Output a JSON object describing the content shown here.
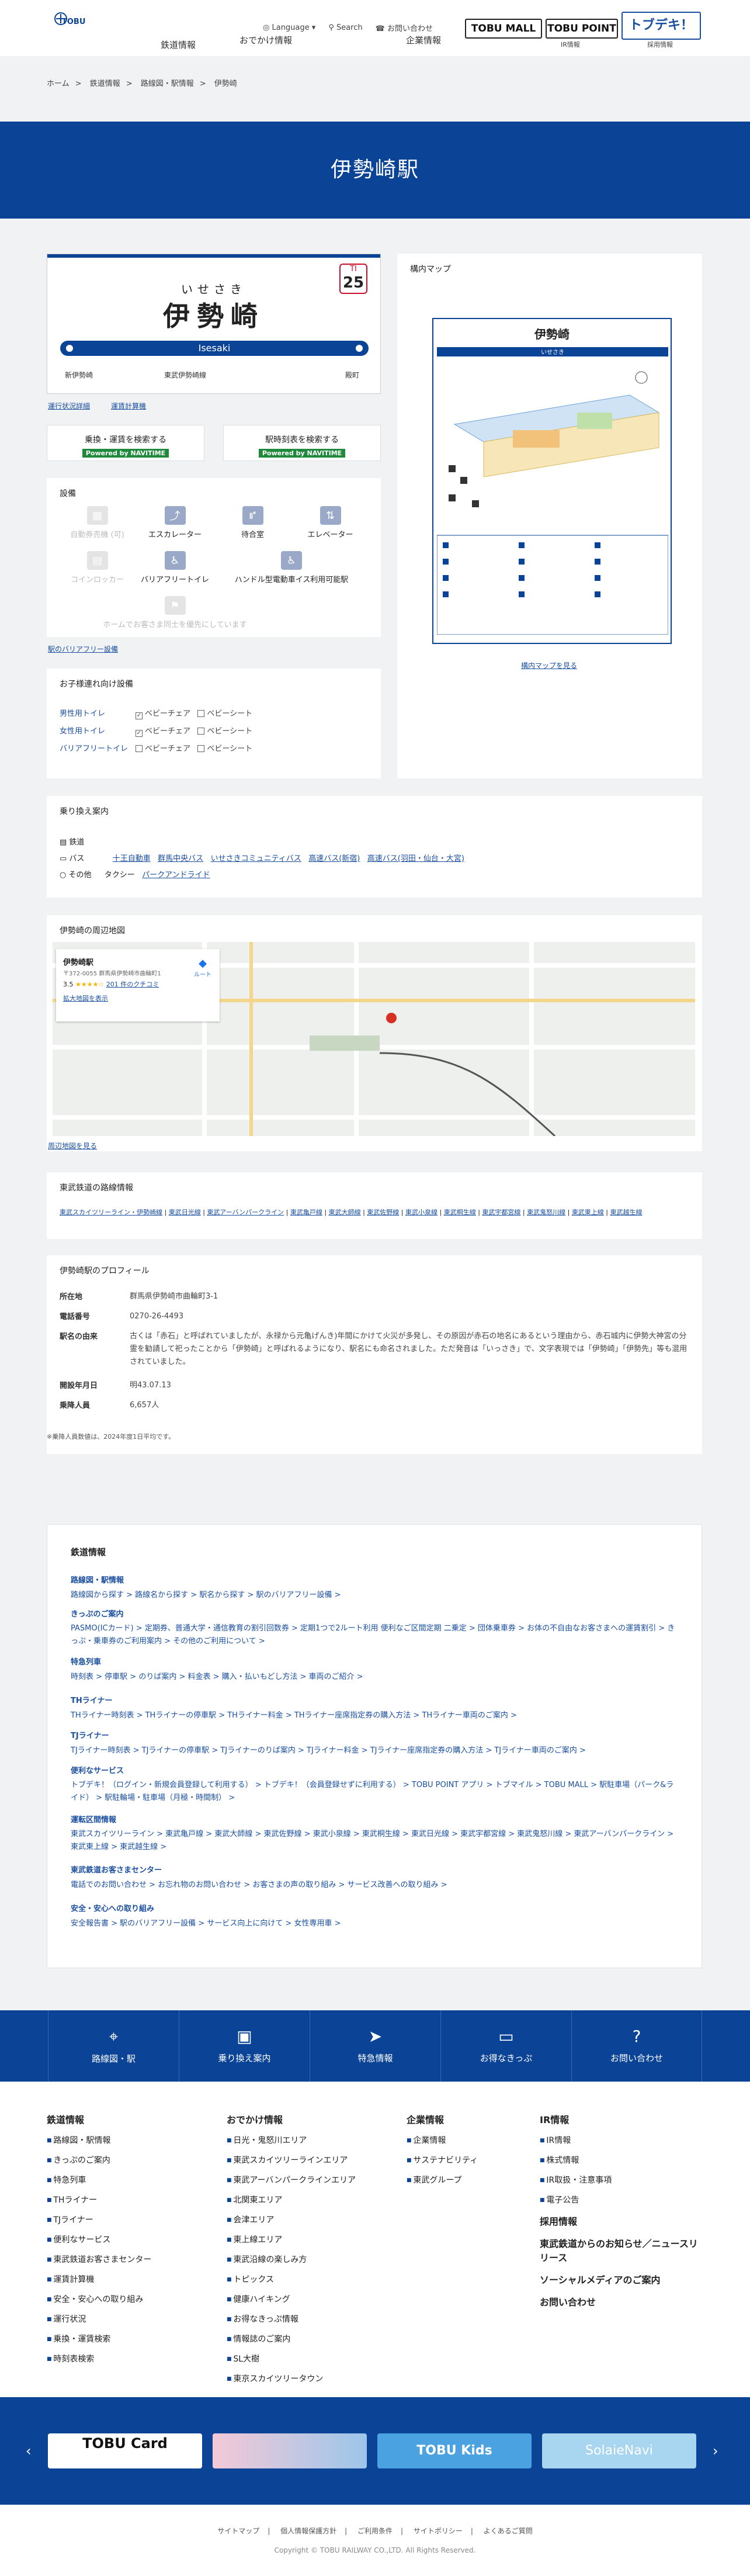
{
  "header": {
    "logo_text": "TOBU",
    "nav": [
      "鉄道情報",
      "おでかけ情報",
      "企業情報",
      "IR情報"
    ],
    "util": {
      "language": "Language",
      "search": "Search",
      "contact": "お問い合わせ"
    },
    "buttons": {
      "mall": "TOBU MALL",
      "point": "TOBU POINT",
      "tobudeki": "トブデキ！"
    },
    "button_sub": {
      "ir": "IR情報",
      "recruit": "採用情報"
    }
  },
  "breadcrumb": [
    "ホーム",
    "鉄道情報",
    "路線図・駅情報",
    "伊勢崎"
  ],
  "hero_title": "伊勢崎駅",
  "sign": {
    "kana": "いせさき",
    "kanji": "伊勢崎",
    "romaji": "Isesaki",
    "number_line": "TI",
    "number": "25",
    "prev": "新伊勢崎",
    "prev2": "東武伊勢崎線",
    "next": "殿町"
  },
  "links": {
    "timetable": "運行状況詳細",
    "nearby": "運賃計算機 "
  },
  "search_buttons": [
    {
      "label": "乗換・運賃を検索する",
      "powered": "Powered by NAVITIME"
    },
    {
      "label": "駅時刻表を検索する",
      "powered": "Powered by NAVITIME"
    }
  ],
  "facilities": {
    "title": "設備",
    "items": [
      {
        "label": "自動券売機 (可)",
        "on": false
      },
      {
        "label": "エスカレーター",
        "on": true
      },
      {
        "label": "待合室",
        "on": true
      },
      {
        "label": "エレベーター",
        "on": true
      },
      {
        "label": "コインロッカー",
        "on": false
      },
      {
        "label": "バリアフリートイレ",
        "on": true
      },
      {
        "label": "ハンドル型電動車イス利用可能駅",
        "on": true
      },
      {
        "label": "ホームでお客さま同士を優先にしています",
        "on": false
      }
    ],
    "link": "駅のバリアフリー設備 "
  },
  "station_map": {
    "title": "構内マップ",
    "station": "伊勢崎",
    "kana": "いせさき",
    "link": "構内マップを見る"
  },
  "care": {
    "title": "お子様連れ向け設備",
    "rows": [
      {
        "name": "男性用トイレ",
        "a": "ベビーチェア",
        "b": "ベビーシート"
      },
      {
        "name": "女性用トイレ",
        "a": "ベビーチェア",
        "b": "ベビーシート"
      },
      {
        "name": "バリアフリートイレ",
        "a": "ベビーチェア",
        "b": "ベビーシート"
      }
    ]
  },
  "transfer": {
    "title": "乗り換え案内",
    "rail": "鉄道",
    "bus_label": "バス",
    "bus": [
      "十王自動車",
      "群馬中央バス",
      "いせさきコミュニティバス",
      "高速バス(新宿)",
      "高速バス(羽田・仙台・大宮)"
    ],
    "other_label": "その他",
    "taxi": "タクシー",
    "parking": "パークアンドライド"
  },
  "nearby_map": {
    "title": "伊勢崎の周辺地図",
    "place": "伊勢崎駅",
    "address": "〒372-0055 群馬県伊勢崎市曲輪町1",
    "rating": "3.5",
    "reviews": "201 件のクチコミ",
    "enlarge": "拡大地図を表示",
    "route": "ルート",
    "link": "周辺地図を見る"
  },
  "lines": {
    "title": "東武鉄道の路線情報",
    "items": [
      "東武スカイツリーライン・伊勢崎線",
      "東武日光線",
      "東武アーバンパークライン",
      "東武亀戸線",
      "東武大師線",
      "東武佐野線",
      "東武小泉線",
      "東武桐生線",
      "東武宇都宮線",
      "東武鬼怒川線",
      "東武東上線",
      "東武越生線"
    ]
  },
  "profile": {
    "title": "伊勢崎駅のプロフィール",
    "rows": [
      {
        "k": "所在地",
        "v": "群馬県伊勢崎市曲輪町3-1"
      },
      {
        "k": "電話番号",
        "v": "0270-26-4493"
      },
      {
        "k": "駅名の由来",
        "v": "古くは「赤石」と呼ばれていましたが、永禄から元亀げんき)年間にかけて火災が多発し、その原因が赤石の地名にあるという理由から、赤石城内に伊勢大神宮の分霊を勧請して祀ったことから「伊勢崎」と呼ばれるようになり、駅名にも命名されました。ただ発音は「いっさき」で、文字表現では「伊勢崎」「伊勢先」等も混用されていました。"
      },
      {
        "k": "開設年月日",
        "v": "明43.07.13"
      },
      {
        "k": "乗降人員",
        "v": "6,657人"
      }
    ],
    "note": "※乗降人員数値は、2024年度1日平均です。"
  },
  "sitemap": {
    "title": "鉄道情報",
    "groups": [
      {
        "h": "路線図・駅情報",
        "l": "路線図から探す >   路線名から探す >   駅名から探す >   駅のバリアフリー設備 >"
      },
      {
        "h": "きっぷのご案内",
        "l": "PASMO(ICカード) >   定期券、普通大学・通信教育の割引回数券 >   定期1つで2ルート利用 便利なご区間定期 二乗定 >   団体乗車券 >   お体の不自由なお客さまへの運賃割引 >   きっぷ・乗車券のご利用案内 >   その他のご利用について >"
      },
      {
        "h": "特急列車",
        "l": "時刻表 >   停車駅 >   のりば案内 >   料金表 >   購入・払いもどし方法 >   車両のご紹介 >"
      },
      {
        "h": "THライナー",
        "l": "THライナー時刻表 >   THライナーの停車駅 >   THライナー料金 >   THライナー座席指定券の購入方法 >   THライナー車両のご案内 >"
      },
      {
        "h": "TJライナー",
        "l": "TJライナー時刻表 >   TJライナーの停車駅 >   TJライナーのりば案内 >   TJライナー料金 >   TJライナー座席指定券の購入方法 >   TJライナー車両のご案内 >"
      },
      {
        "h": "便利なサービス",
        "l": "トブデキ！（ログイン・新規会員登録して利用する） >   トブデキ！（会員登録せずに利用する） >   TOBU POINT アプリ >   トブマイル >   TOBU MALL >   駅駐車場（パーク&ライド） >   駅駐輪場・駐車場（月極・時間制） >"
      },
      {
        "h": "運転区間情報",
        "l": "東武スカイツリーライン >   東武亀戸線 >   東武大師線 >   東武佐野線 >   東武小泉線 >   東武桐生線 >   東武日光線 >   東武宇都宮線 >   東武鬼怒川線 >   東武アーバンパークライン >   東武東上線 >   東武越生線 >"
      },
      {
        "h": "東武鉄道お客さまセンター",
        "l": "電話でのお問い合わせ >   お忘れ物のお問い合わせ >   お客さまの声の取り組み >   サービス改善への取り組み >"
      },
      {
        "h": "安全・安心への取り組み",
        "l": "安全報告書 >   駅のバリアフリー設備 >   サービス向上に向けて >   女性専用車 >"
      }
    ]
  },
  "bottom_nav": [
    {
      "icon": "route-icon",
      "label": "路線図・駅"
    },
    {
      "icon": "train-icon",
      "label": "乗り換え案内"
    },
    {
      "icon": "express-icon",
      "label": "特急情報"
    },
    {
      "icon": "ticket-icon",
      "label": "お得なきっぷ"
    },
    {
      "icon": "question-icon",
      "label": "お問い合わせ"
    }
  ],
  "footer": {
    "cols": [
      {
        "h": "鉄道情報",
        "items": [
          "路線図・駅情報",
          "きっぷのご案内",
          "特急列車",
          "THライナー",
          "TJライナー",
          "便利なサービス",
          "東武鉄道お客さまセンター",
          "運賃計算機",
          "安全・安心への取り組み",
          "運行状況",
          "乗換・運賃検索",
          "時刻表検索"
        ]
      },
      {
        "h": "おでかけ情報",
        "items": [
          "日光・鬼怒川エリア",
          "東武スカイツリーラインエリア",
          "東武アーバンパークラインエリア",
          "北関東エリア",
          "会津エリア",
          "東上線エリア",
          "東武沿線の楽しみ方",
          "トピックス",
          "健康ハイキング",
          "お得なきっぷ情報",
          "情報誌のご案内",
          "SL大樹",
          "東京スカイツリータウン"
        ]
      },
      {
        "h": "企業情報",
        "items": [
          "企業情報",
          "サステナビリティ",
          "東武グループ"
        ]
      },
      {
        "h": "IR情報",
        "items": [
          "IR情報",
          "株式情報",
          "IR取扱・注意事項",
          "電子公告"
        ]
      }
    ],
    "extra": [
      "採用情報",
      "東武鉄道からのお知らせ／ニュースリリース",
      "ソーシャルメディアのご案内",
      "お問い合わせ"
    ],
    "links": [
      "サイトマップ",
      "個人情報保護方針",
      "ご利用条件",
      "サイトポリシー",
      "よくあるご質問"
    ],
    "copyright": "Copyright © TOBU RAILWAY CO.,LTD. All Rights Reserved.",
    "banners": [
      "TOBU Card",
      "",
      "TOBU Kids",
      "SolaieNavi"
    ]
  }
}
